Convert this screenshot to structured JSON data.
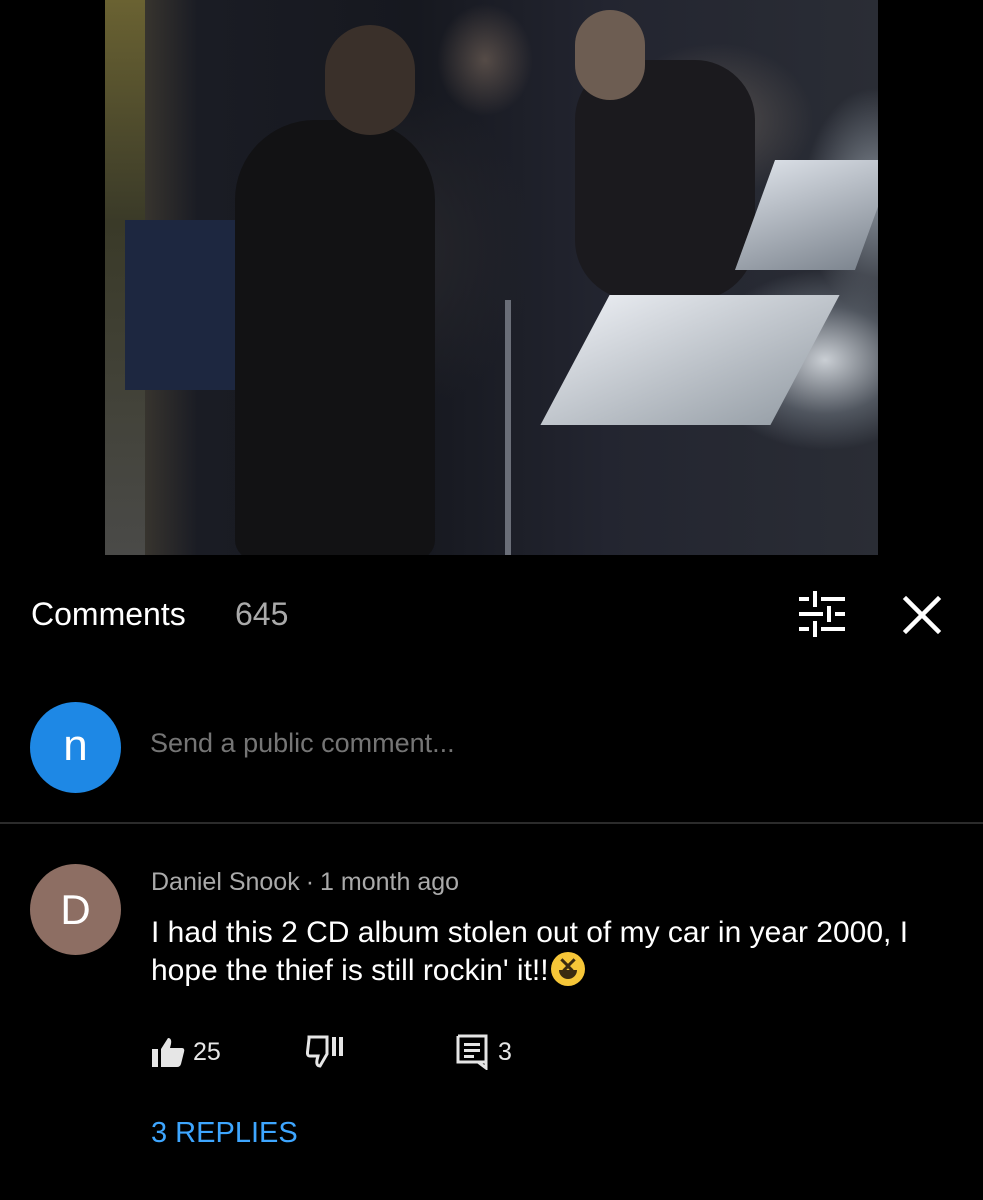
{
  "video": {
    "description_icon": "video-frame-icon"
  },
  "comments_header": {
    "title": "Comments",
    "count": "645",
    "sort_icon": "sort-filter-icon",
    "close_icon": "close-icon"
  },
  "compose": {
    "avatar_letter": "n",
    "avatar_color": "#1e88e5",
    "placeholder": "Send a public comment..."
  },
  "comment": {
    "avatar_letter": "D",
    "avatar_color": "#8d6e63",
    "author": "Daniel Snook",
    "separator": "·",
    "time": "1 month ago",
    "text": "I had this 2 CD album stolen out of my car in year 2000, I hope the thief is still rockin' it!!",
    "emoji": "laughing-face-emoji",
    "likes": "25",
    "reply_count": "3",
    "replies_label": "3 REPLIES"
  },
  "colors": {
    "background": "#000000",
    "link": "#3ea6ff",
    "secondary_text": "#aaaaaa"
  }
}
